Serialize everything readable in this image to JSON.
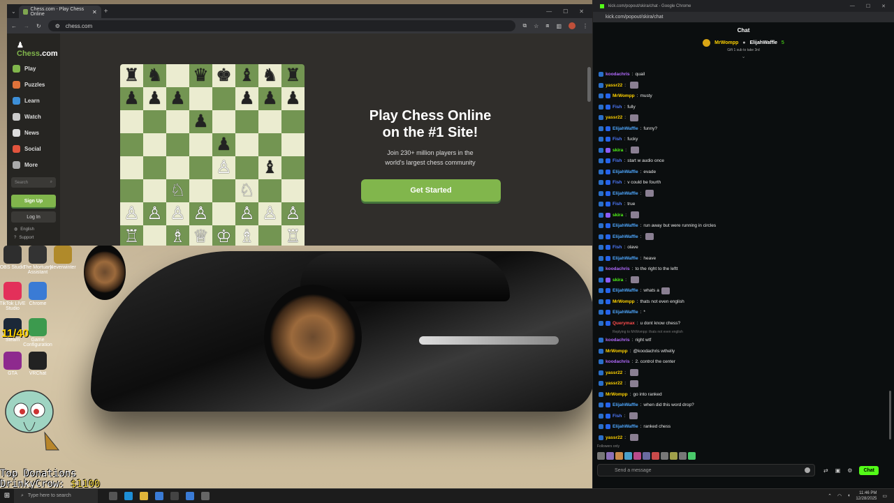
{
  "browser": {
    "tab_title": "Chess.com - Play Chess Online",
    "url": "chess.com",
    "new_tab": "+"
  },
  "chesscom": {
    "logo_main": "Chess",
    "logo_suffix": ".com",
    "nav": [
      {
        "label": "Play",
        "color": "#81b64c"
      },
      {
        "label": "Puzzles",
        "color": "#e0723a"
      },
      {
        "label": "Learn",
        "color": "#3d8fd8"
      },
      {
        "label": "Watch",
        "color": "#cccccc"
      },
      {
        "label": "News",
        "color": "#dddddd"
      },
      {
        "label": "Social",
        "color": "#e2543d"
      },
      {
        "label": "More",
        "color": "#aaaaaa"
      }
    ],
    "search_placeholder": "Search",
    "signup": "Sign Up",
    "login": "Log In",
    "language": "English",
    "support": "Support",
    "headline_1": "Play Chess Online",
    "headline_2": "on the #1 Site!",
    "subtext_1": "Join 230+ million players in the",
    "subtext_2": "world's largest chess community",
    "cta": "Get Started",
    "board": [
      [
        "♜",
        "♞",
        "",
        "♛",
        "♚",
        "♝",
        "♞",
        "♜"
      ],
      [
        "♟",
        "♟",
        "♟",
        "",
        "",
        "♟",
        "♟",
        "♟"
      ],
      [
        "",
        "",
        "",
        "♟",
        "",
        "",
        "",
        ""
      ],
      [
        "",
        "",
        "",
        "",
        "♟",
        "",
        "",
        ""
      ],
      [
        "",
        "",
        "",
        "",
        "♙",
        "",
        "♝",
        ""
      ],
      [
        "",
        "",
        "♘",
        "",
        "",
        "♘",
        "",
        ""
      ],
      [
        "♙",
        "♙",
        "♙",
        "♙",
        "",
        "♙",
        "♙",
        "♙"
      ],
      [
        "♖",
        "",
        "♗",
        "♕",
        "♔",
        "♗",
        "",
        "♖"
      ]
    ],
    "white_pieces": "♙♘♗♖♕♔"
  },
  "desktop": {
    "counter": "11/40",
    "donation_title": "Top Donations",
    "donation_name": "DrinkyCrow:",
    "donation_amount": "$1100",
    "icons": [
      {
        "label": "OBS Studio",
        "color": "#2e2e2e"
      },
      {
        "label": "The Mortuary Assistant",
        "color": "#333333"
      },
      {
        "label": "Neverwinter",
        "color": "#b08a2a"
      },
      {
        "label": "TikTok LIVE Studio",
        "color": "#e3305a"
      },
      {
        "label": "Chrome",
        "color": "#3a7bd5"
      },
      {
        "label": "Steam",
        "color": "#1b2838"
      },
      {
        "label": "Game Configuration",
        "color": "#3c9a4e"
      },
      {
        "label": "GTA",
        "color": "#8e2a8e"
      },
      {
        "label": "VRChat",
        "color": "#222222"
      }
    ]
  },
  "chat": {
    "window_title": "kick.com/popout/skira/chat - Google Chrome",
    "url": "kick.com/popout/skira/chat",
    "header": "Chat",
    "pinned_user_1": "MrWompp",
    "pinned_user_2": "ElijahWaffle",
    "pinned_count": "5",
    "pinned_sub": "Gift 1 sub to take 3rd",
    "messages": [
      {
        "user": "koodachris",
        "color": "#b36bff",
        "text": "quail",
        "badge": ""
      },
      {
        "user": "yassr22",
        "color": "#ffd200",
        "text": "",
        "badge": "",
        "emote": true
      },
      {
        "user": "MrWompp",
        "color": "#ffd200",
        "text": "musty",
        "badge": "#2563eb"
      },
      {
        "user": "Fish",
        "color": "#4f7bff",
        "text": "fully",
        "badge": "#2563eb"
      },
      {
        "user": "yassr22",
        "color": "#ffd200",
        "text": "",
        "badge": "",
        "emote": true
      },
      {
        "user": "ElijahWaffle",
        "color": "#4fa8ff",
        "text": "funny?",
        "badge": "#2563eb"
      },
      {
        "user": "Fish",
        "color": "#4f7bff",
        "text": "fucky",
        "badge": "#2563eb"
      },
      {
        "user": "skira",
        "color": "#53fc18",
        "text": "",
        "badge": "#8b5cf6",
        "emote": true
      },
      {
        "user": "Fish",
        "color": "#4f7bff",
        "text": "start w audio once",
        "badge": "#2563eb"
      },
      {
        "user": "ElijahWaffle",
        "color": "#4fa8ff",
        "text": "evade",
        "badge": "#2563eb"
      },
      {
        "user": "Fish",
        "color": "#4f7bff",
        "text": "v could be fourth",
        "badge": "#2563eb"
      },
      {
        "user": "ElijahWaffle",
        "color": "#4fa8ff",
        "text": "",
        "badge": "#2563eb",
        "emote": true
      },
      {
        "user": "Fish",
        "color": "#4f7bff",
        "text": "true",
        "badge": "#2563eb"
      },
      {
        "user": "skira",
        "color": "#53fc18",
        "text": "",
        "badge": "#8b5cf6",
        "emote": true
      },
      {
        "user": "ElijahWaffle",
        "color": "#4fa8ff",
        "text": "run away but were running in circles",
        "badge": "#2563eb"
      },
      {
        "user": "ElijahWaffle",
        "color": "#4fa8ff",
        "text": "",
        "badge": "#2563eb",
        "emote": true
      },
      {
        "user": "Fish",
        "color": "#4f7bff",
        "text": "olave",
        "badge": "#2563eb"
      },
      {
        "user": "ElijahWaffle",
        "color": "#4fa8ff",
        "text": "heave",
        "badge": "#2563eb"
      },
      {
        "user": "koodachris",
        "color": "#b36bff",
        "text": "to the right to the leftt",
        "badge": ""
      },
      {
        "user": "skira",
        "color": "#53fc18",
        "text": "",
        "badge": "#8b5cf6",
        "emote": true
      },
      {
        "user": "ElijahWaffle",
        "color": "#4fa8ff",
        "text": "whats a",
        "badge": "#2563eb",
        "emote": true
      },
      {
        "user": "MrWompp",
        "color": "#ffd200",
        "text": "thats not even english",
        "badge": "#2563eb"
      },
      {
        "user": "ElijahWaffle",
        "color": "#4fa8ff",
        "text": "*",
        "badge": "#2563eb"
      },
      {
        "user": "Querymax",
        "color": "#ff4d4d",
        "text": "u dont know chess?",
        "badge": "#2563eb"
      },
      {
        "reply": "Replying to MrWompp: thats not even english"
      },
      {
        "user": "koodachris",
        "color": "#b36bff",
        "text": "right wtf",
        "badge": ""
      },
      {
        "user": "MrWompp",
        "color": "#ffd200",
        "text": "@koodachris wthelly",
        "badge": ""
      },
      {
        "user": "koodachris",
        "color": "#b36bff",
        "text": "2. control the center",
        "badge": ""
      },
      {
        "user": "yassr22",
        "color": "#ffd200",
        "text": "",
        "badge": "",
        "emote": true
      },
      {
        "user": "yassr22",
        "color": "#ffd200",
        "text": "",
        "badge": "",
        "emote": true
      },
      {
        "user": "MrWompp",
        "color": "#ffd200",
        "text": "go into ranked",
        "badge": ""
      },
      {
        "user": "ElijahWaffle",
        "color": "#4fa8ff",
        "text": "when did this word drop?",
        "badge": "#2563eb"
      },
      {
        "user": "Fish",
        "color": "#4f7bff",
        "text": "",
        "badge": "#2563eb",
        "emote": true
      },
      {
        "user": "ElijahWaffle",
        "color": "#4fa8ff",
        "text": "ranked chess",
        "badge": "#2563eb"
      },
      {
        "user": "yassr22",
        "color": "#ffd200",
        "text": "",
        "badge": "",
        "emote": true
      }
    ],
    "followers_only": "Followers only",
    "input_placeholder": "Send a message",
    "send_label": "Chat"
  },
  "taskbar": {
    "search_placeholder": "Type here to search",
    "time": "11:46 PM",
    "date": "12/28/2025"
  }
}
